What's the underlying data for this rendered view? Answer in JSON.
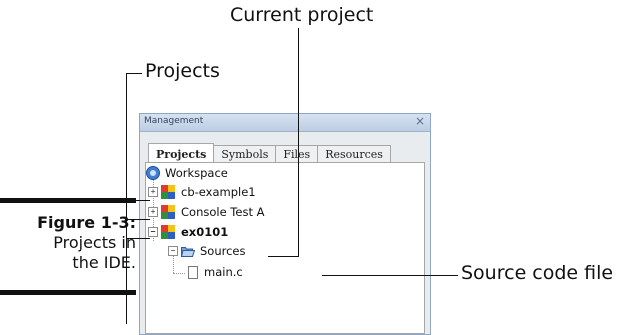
{
  "callouts": {
    "current_project": "Current project",
    "projects": "Projects",
    "source_code_file": "Source code file"
  },
  "caption": {
    "label": "Figure 1-3:",
    "line1": "Projects in",
    "line2": "the IDE."
  },
  "panel": {
    "title": "Management",
    "close": "×",
    "tabs": [
      "Projects",
      "Symbols",
      "Files",
      "Resources"
    ],
    "active_tab": "Projects"
  },
  "tree": {
    "workspace": "Workspace",
    "projects": [
      "cb-example1",
      "Console Test A",
      "ex0101"
    ],
    "current_project": "ex0101",
    "folder": "Sources",
    "file": "main.c",
    "expand_symbol": "+",
    "collapse_symbol": "−"
  },
  "colors": {
    "panel_border": "#8fa7c3",
    "titlebar": "#bccde3",
    "callout_line": "#111111"
  }
}
